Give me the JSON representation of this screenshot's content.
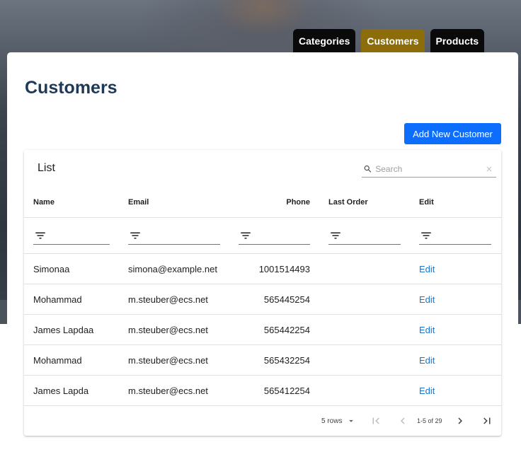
{
  "nav": {
    "tabs": [
      {
        "label": "Categories",
        "active": false
      },
      {
        "label": "Customers",
        "active": true
      },
      {
        "label": "Products",
        "active": false
      }
    ]
  },
  "page": {
    "title": "Customers",
    "add_button_label": "Add New Customer"
  },
  "table": {
    "title": "List",
    "search_placeholder": "Search",
    "columns": [
      "Name",
      "Email",
      "Phone",
      "Last Order",
      "Edit"
    ],
    "rows": [
      {
        "name": "Simonaa",
        "email": "simona@example.net",
        "phone": "1001514493",
        "last_order": "",
        "edit": "Edit"
      },
      {
        "name": "Mohammad",
        "email": "m.steuber@ecs.net",
        "phone": "565445254",
        "last_order": "",
        "edit": "Edit"
      },
      {
        "name": "James Lapdaa",
        "email": "m.steuber@ecs.net",
        "phone": "565442254",
        "last_order": "",
        "edit": "Edit"
      },
      {
        "name": "Mohammad",
        "email": "m.steuber@ecs.net",
        "phone": "565432254",
        "last_order": "",
        "edit": "Edit"
      },
      {
        "name": "James Lapda",
        "email": "m.steuber@ecs.net",
        "phone": "565412254",
        "last_order": "",
        "edit": "Edit"
      }
    ],
    "pagination": {
      "rows_label": "5 rows",
      "range": "1-5 of 29"
    }
  },
  "icons": {
    "search": "search-icon",
    "clear": "close-icon",
    "filter": "filter-icon",
    "dropdown": "arrow-drop-down-icon",
    "first": "first-page-icon",
    "prev": "chevron-left-icon",
    "next": "chevron-right-icon",
    "last": "last-page-icon"
  },
  "colors": {
    "active_tab": "#8c6d0a",
    "primary_button": "#0d6efd",
    "title": "#1f3a57",
    "link": "#1976d2"
  }
}
